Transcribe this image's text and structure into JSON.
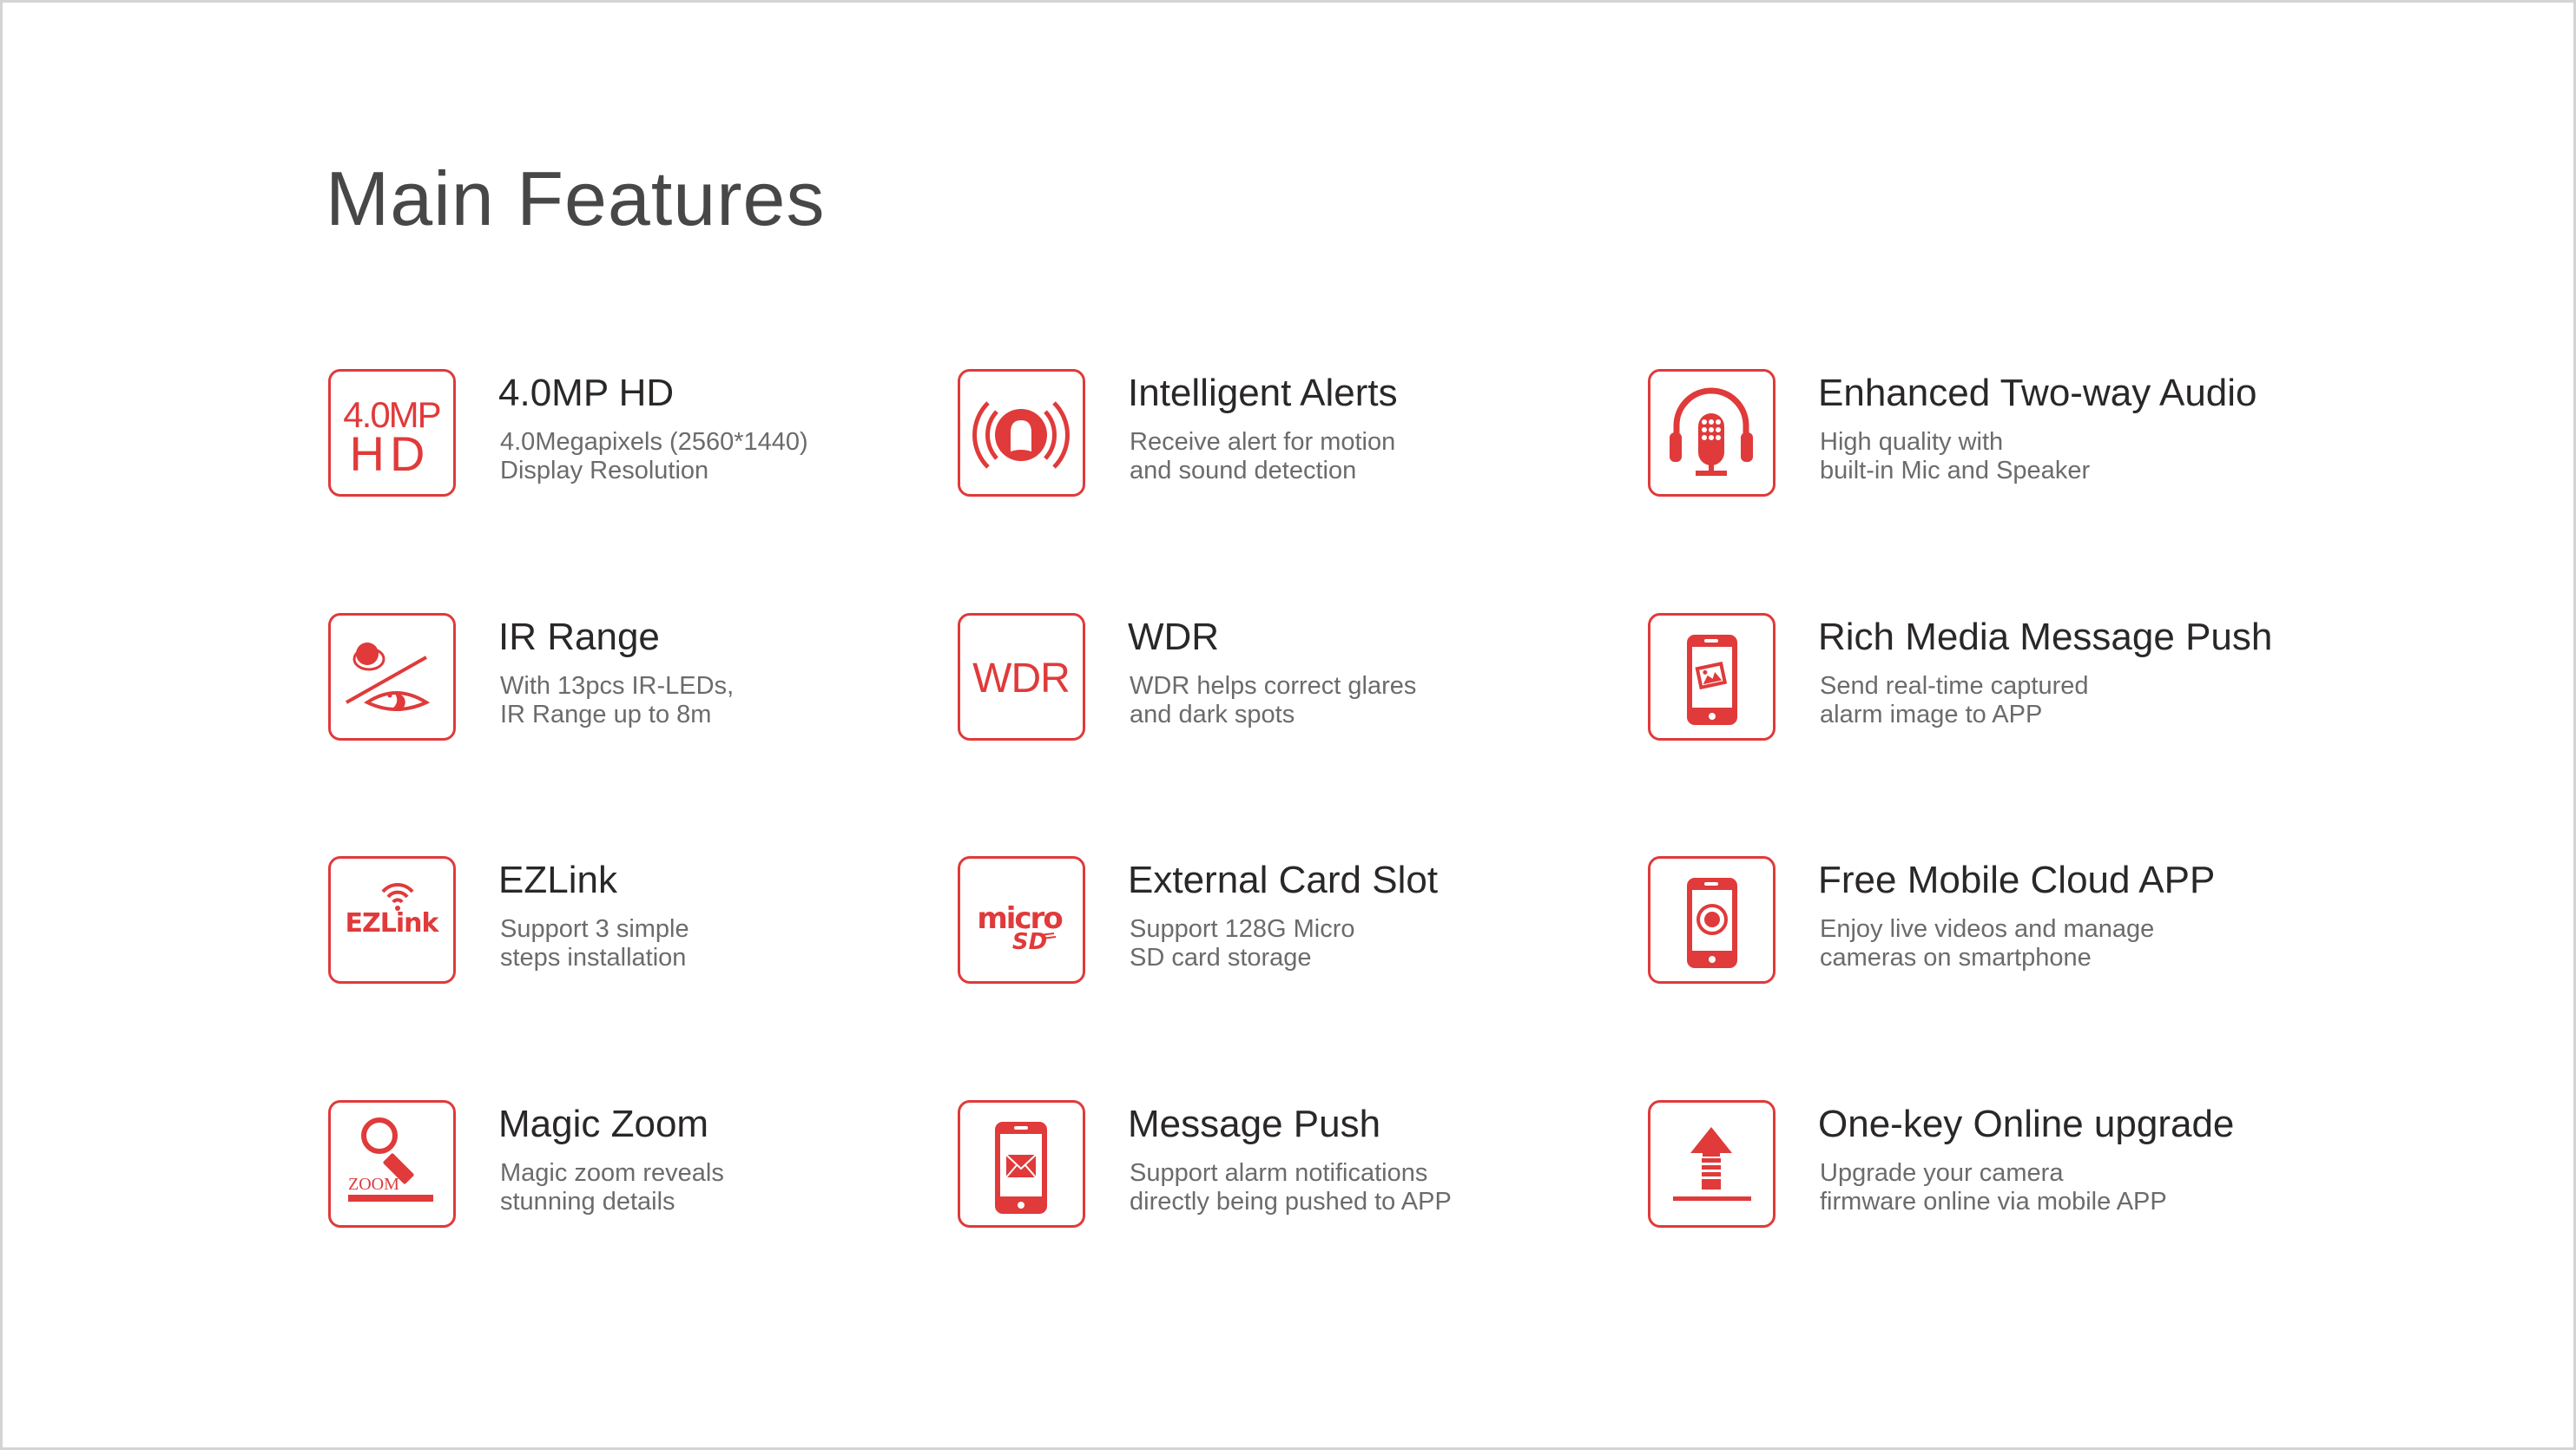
{
  "page": {
    "title": "Main Features",
    "accent_color": "#e03a3a",
    "features": [
      {
        "title": "4.0MP HD",
        "desc": [
          "4.0Megapixels (2560*1440)",
          "Display Resolution"
        ],
        "icon": "4mp-hd-icon",
        "icon_text": [
          "4.0MP",
          "HD"
        ]
      },
      {
        "title": "Intelligent Alerts",
        "desc": [
          "Receive alert for motion",
          "and sound detection"
        ],
        "icon": "alarm-alert-icon"
      },
      {
        "title": "Enhanced Two-way Audio",
        "desc": [
          "High quality with",
          "built-in Mic and Speaker"
        ],
        "icon": "headset-mic-icon"
      },
      {
        "title": "IR Range",
        "desc": [
          "With 13pcs IR-LEDs,",
          "IR Range up to 8m"
        ],
        "icon": "night-vision-eye-icon"
      },
      {
        "title": "WDR",
        "desc": [
          "WDR helps correct glares",
          "and dark spots"
        ],
        "icon": "wdr-icon",
        "icon_text": [
          "WDR"
        ]
      },
      {
        "title": "Rich Media Message Push",
        "desc": [
          "Send real-time captured",
          "alarm image to APP"
        ],
        "icon": "phone-image-icon"
      },
      {
        "title": "EZLink",
        "desc": [
          "Support 3 simple",
          "steps installation"
        ],
        "icon": "ezlink-wifi-icon",
        "icon_text": [
          "EZLink"
        ]
      },
      {
        "title": "External Card Slot",
        "desc": [
          "Support 128G Micro",
          "SD card storage"
        ],
        "icon": "micro-sd-icon",
        "icon_text": [
          "micro",
          "SD"
        ]
      },
      {
        "title": "Free Mobile Cloud APP",
        "desc": [
          "Enjoy live videos and manage",
          "cameras on smartphone"
        ],
        "icon": "phone-camera-icon"
      },
      {
        "title": "Magic Zoom",
        "desc": [
          "Magic zoom reveals",
          "stunning details"
        ],
        "icon": "magnifier-zoom-icon",
        "icon_text": [
          "ZOOM"
        ]
      },
      {
        "title": "Message Push",
        "desc": [
          "Support alarm notifications",
          "directly being pushed to APP"
        ],
        "icon": "phone-envelope-icon"
      },
      {
        "title": "One-key Online upgrade",
        "desc": [
          "Upgrade your camera",
          "firmware online via mobile APP"
        ],
        "icon": "upload-arrow-icon"
      }
    ]
  }
}
